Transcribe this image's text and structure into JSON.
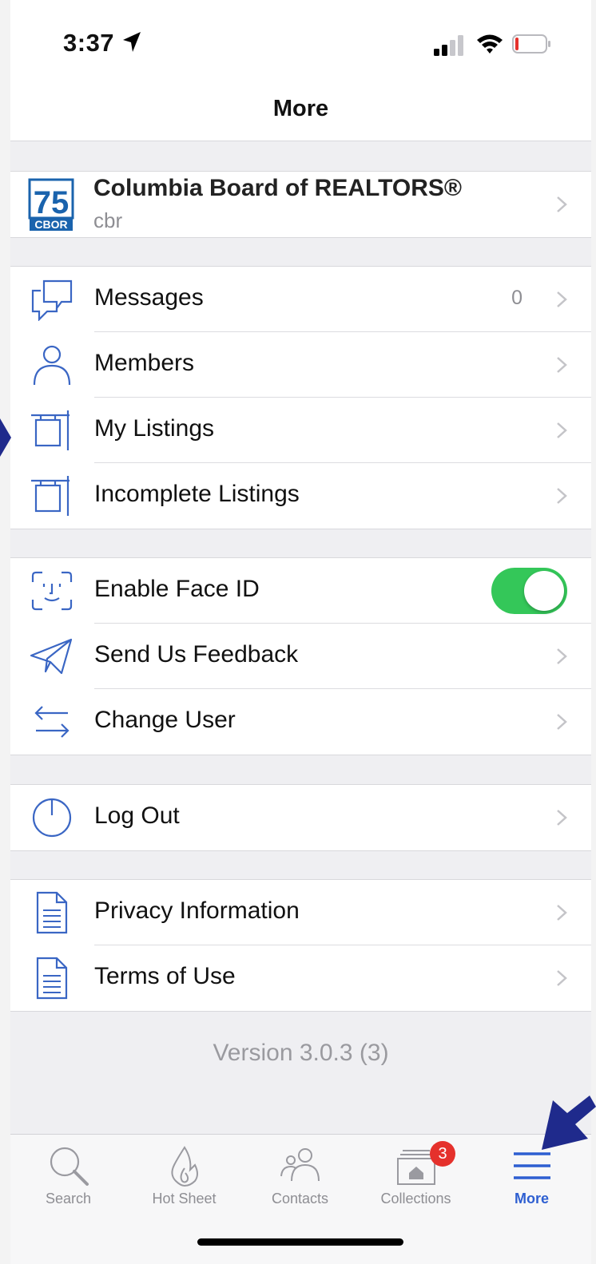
{
  "status_bar": {
    "time": "3:37"
  },
  "header": {
    "title": "More"
  },
  "organization": {
    "name": "Columbia Board of REALTORS®",
    "subtitle": "cbr",
    "logo_number": "75",
    "logo_text": "CBOR"
  },
  "group1": [
    {
      "label": "Messages",
      "count": "0",
      "icon": "chat-bubbles-icon"
    },
    {
      "label": "Members",
      "icon": "person-icon"
    },
    {
      "label": "My Listings",
      "icon": "listing-sign-icon"
    },
    {
      "label": "Incomplete Listings",
      "icon": "listing-sign-icon"
    }
  ],
  "group2": [
    {
      "label": "Enable Face ID",
      "icon": "face-id-icon",
      "toggle_on": true
    },
    {
      "label": "Send Us Feedback",
      "icon": "paper-plane-icon"
    },
    {
      "label": "Change User",
      "icon": "swap-arrows-icon"
    }
  ],
  "group3": [
    {
      "label": "Log Out",
      "icon": "power-icon"
    }
  ],
  "group4": [
    {
      "label": "Privacy Information",
      "icon": "document-icon"
    },
    {
      "label": "Terms of Use",
      "icon": "document-icon"
    }
  ],
  "version": "Version 3.0.3 (3)",
  "tabs": [
    {
      "label": "Search",
      "icon": "magnifier-icon"
    },
    {
      "label": "Hot Sheet",
      "icon": "flame-icon"
    },
    {
      "label": "Contacts",
      "icon": "people-icon"
    },
    {
      "label": "Collections",
      "icon": "collection-house-icon",
      "badge": "3"
    },
    {
      "label": "More",
      "icon": "hamburger-icon",
      "active": true
    }
  ],
  "colors": {
    "accent": "#2e5fd1",
    "icon_blue": "#3a66c4",
    "toggle_green": "#34c759",
    "badge_red": "#e5312c",
    "pointer": "#1f2a8c"
  }
}
